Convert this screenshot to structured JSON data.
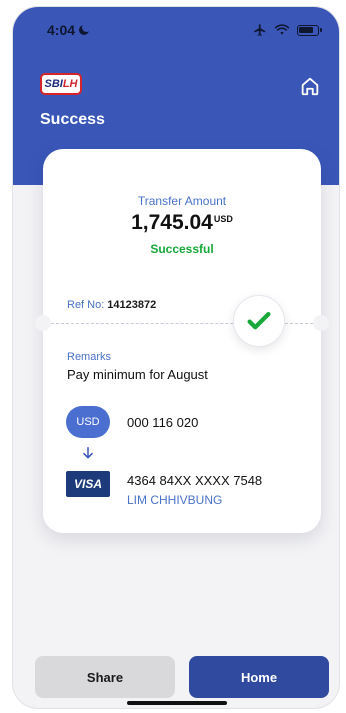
{
  "status_bar": {
    "time": "4:04"
  },
  "header": {
    "logo_text": "SBI",
    "logo_text_accent": "LH",
    "title": "Success"
  },
  "transfer": {
    "amount_label": "Transfer Amount",
    "amount": "1,745.04",
    "currency": "USD",
    "status": "Successful",
    "ref_label": "Ref No:",
    "ref_value": "14123872"
  },
  "remarks": {
    "label": "Remarks",
    "value": "Pay minimum for August"
  },
  "from": {
    "currency_badge": "USD",
    "account": "000 116 020"
  },
  "to": {
    "card_brand": "VISA",
    "card_number": "4364 84XX XXXX 7548",
    "holder": "LIM CHHIVBUNG"
  },
  "buttons": {
    "share": "Share",
    "home": "Home"
  },
  "colors": {
    "brand_blue": "#3a57b8",
    "primary_button": "#2f4a9e",
    "accent_text": "#4a72c7",
    "success_green": "#18a83a",
    "logo_red": "#d3252b"
  },
  "icons": [
    "moon-icon",
    "airplane-icon",
    "wifi-icon",
    "battery-icon",
    "home-icon",
    "check-icon",
    "down-arrow-icon"
  ]
}
